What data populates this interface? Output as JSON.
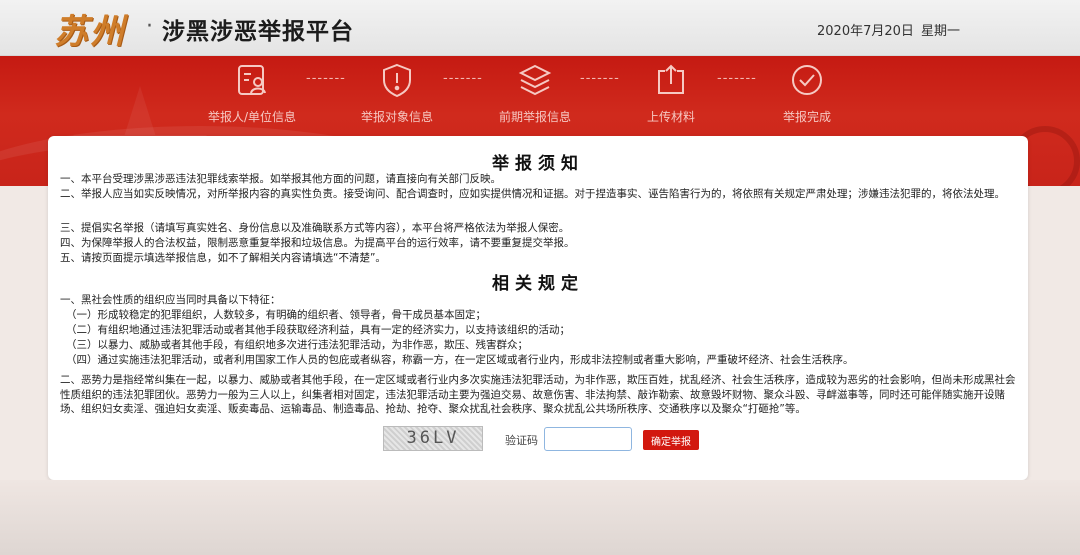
{
  "header": {
    "city_logo": "苏州",
    "title": "涉黑涉恶举报平台",
    "date": "2020年7月20日",
    "weekday": "星期一"
  },
  "steps": [
    {
      "label": "举报人/单位信息",
      "icon": "person-card-icon"
    },
    {
      "label": "举报对象信息",
      "icon": "shield-alert-icon"
    },
    {
      "label": "前期举报信息",
      "icon": "layers-icon"
    },
    {
      "label": "上传材料",
      "icon": "upload-icon"
    },
    {
      "label": "举报完成",
      "icon": "check-circle-icon"
    }
  ],
  "separator": "-------",
  "notice": {
    "title": "举报须知",
    "lines": [
      "一、本平台受理涉黑涉恶违法犯罪线索举报。如举报其他方面的问题，请直接向有关部门反映。",
      "二、举报人应当如实反映情况，对所举报内容的真实性负责。接受询问、配合调查时，应如实提供情况和证据。对于捏造事实、诬告陷害行为的，将依照有关规定严肃处理；涉嫌违法犯罪的，将依法处理。",
      "三、提倡实名举报（请填写真实姓名、身份信息以及准确联系方式等内容），本平台将严格依法为举报人保密。",
      "四、为保障举报人的合法权益，限制恶意重复举报和垃圾信息。为提高平台的运行效率，请不要重复提交举报。",
      "五、请按页面提示填选举报信息，如不了解相关内容请填选“不清楚”。"
    ]
  },
  "rules": {
    "title": "相关规定",
    "lines": [
      "一、黑社会性质的组织应当同时具备以下特征：",
      "（一）形成较稳定的犯罪组织，人数较多，有明确的组织者、领导者，骨干成员基本固定；",
      "（二）有组织地通过违法犯罪活动或者其他手段获取经济利益，具有一定的经济实力，以支持该组织的活动；",
      "（三）以暴力、威胁或者其他手段，有组织地多次进行违法犯罪活动，为非作恶，欺压、残害群众；",
      "（四）通过实施违法犯罪活动，或者利用国家工作人员的包庇或者纵容，称霸一方，在一定区域或者行业内，形成非法控制或者重大影响，严重破坏经济、社会生活秩序。",
      "二、恶势力是指经常纠集在一起，以暴力、威胁或者其他手段，在一定区域或者行业内多次实施违法犯罪活动，为非作恶，欺压百姓，扰乱经济、社会生活秩序，造成较为恶劣的社会影响，但尚未形成黑社会性质组织的违法犯罪团伙。恶势力一般为三人以上，纠集者相对固定，违法犯罪活动主要为强迫交易、故意伤害、非法拘禁、敲诈勒索、故意毁坏财物、聚众斗殴、寻衅滋事等，同时还可能伴随实施开设赌场、组织妇女卖淫、强迫妇女卖淫、贩卖毒品、运输毒品、制造毒品、抢劫、抢夺、聚众扰乱社会秩序、聚众扰乱公共场所秩序、交通秩序以及聚众“打砸抢”等。"
    ]
  },
  "form": {
    "captcha_text": "36LV",
    "captcha_label": "验证码",
    "captcha_value": "",
    "submit_label": "确定举报"
  },
  "colors": {
    "brand_red": "#c51a12",
    "button_red": "#d2180f",
    "logo_orange": "#cf7d2a"
  }
}
